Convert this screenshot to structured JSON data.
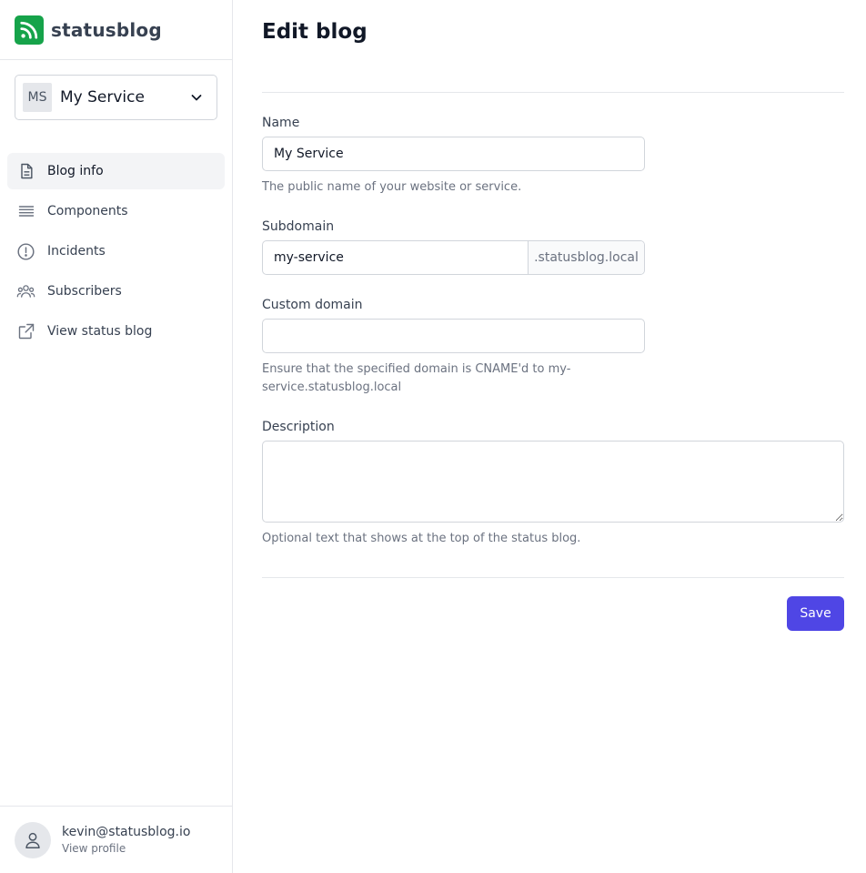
{
  "brand": {
    "name": "statusblog",
    "color": "#16a34a"
  },
  "service_selector": {
    "initials": "MS",
    "name": "My Service"
  },
  "nav": {
    "items": [
      {
        "label": "Blog info",
        "icon": "document-icon",
        "active": true
      },
      {
        "label": "Components",
        "icon": "menu-lines-icon"
      },
      {
        "label": "Incidents",
        "icon": "exclamation-circle-icon"
      },
      {
        "label": "Subscribers",
        "icon": "user-group-icon"
      },
      {
        "label": "View status blog",
        "icon": "external-link-icon"
      }
    ]
  },
  "profile": {
    "email": "kevin@statusblog.io",
    "link": "View profile"
  },
  "page": {
    "title": "Edit blog",
    "name_field": {
      "label": "Name",
      "value": "My Service",
      "help": "The public name of your website or service."
    },
    "subdomain_field": {
      "label": "Subdomain",
      "value": "my-service",
      "suffix": ".statusblog.local"
    },
    "custom_domain_field": {
      "label": "Custom domain",
      "value": "",
      "help": "Ensure that the specified domain is CNAME'd to my-service.statusblog.local"
    },
    "description_field": {
      "label": "Description",
      "value": "",
      "help": "Optional text that shows at the top of the status blog."
    },
    "save_label": "Save"
  },
  "colors": {
    "accent": "#4f46e5",
    "border": "#d1d5db",
    "muted_text": "#6b7280"
  }
}
